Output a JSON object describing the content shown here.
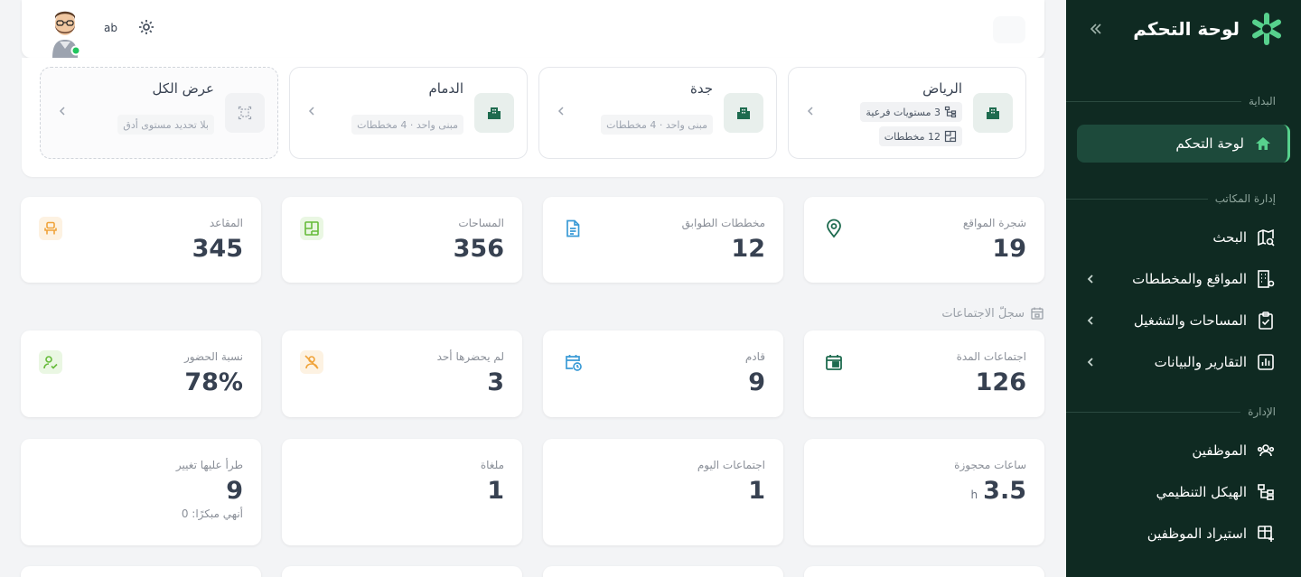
{
  "sidebar": {
    "title": "لوحة التحكم",
    "sections": {
      "start": "البداية",
      "offices": "إدارة المكاتب",
      "admin": "الإدارة"
    },
    "items": {
      "dashboard": "لوحة التحكم",
      "search": "البحث",
      "sites": "المواقع والمخططات",
      "spaces": "المساحات والتشغيل",
      "reports": "التقارير والبيانات",
      "employees": "الموظفين",
      "org": "الهيكل التنظيمي",
      "import": "استيراد الموظفين"
    }
  },
  "topbar": {
    "user_code": "ab"
  },
  "sites": [
    {
      "name": "الرياض",
      "chip1": "3 مستويات فرعية",
      "chip2": "12 مخططات"
    },
    {
      "name": "جدة",
      "chip1": "مبنى واحد · 4 مخططات"
    },
    {
      "name": "الدمام",
      "chip1": "مبنى واحد · 4 مخططات"
    },
    {
      "name": "عرض الكل",
      "chip1": "بلا تحديد مستوى أدق"
    }
  ],
  "stats_row1": [
    {
      "label": "شجرة المواقع",
      "value": "19"
    },
    {
      "label": "مخططات الطوابق",
      "value": "12"
    },
    {
      "label": "المساحات",
      "value": "356"
    },
    {
      "label": "المقاعد",
      "value": "345"
    }
  ],
  "meetings_section": "سجلّ الاجتماعات",
  "stats_row2": [
    {
      "label": "اجتماعات المدة",
      "value": "126"
    },
    {
      "label": "قادم",
      "value": "9"
    },
    {
      "label": "لم يحضرها أحد",
      "value": "3"
    },
    {
      "label": "نسبة الحضور",
      "value": "78%"
    }
  ],
  "stats_row3": [
    {
      "label": "ساعات محجوزة",
      "value": "3.5",
      "unit": "h"
    },
    {
      "label": "اجتماعات اليوم",
      "value": "1"
    },
    {
      "label": "ملغاة",
      "value": "1"
    },
    {
      "label": "طرأ عليها تغيير",
      "value": "9",
      "sub": "أنهي مبكرًا: 0"
    }
  ],
  "colors": {
    "sidebar_bg": "#0f2a22",
    "accent": "#57d18d",
    "green_icon": "#1e6b4f"
  }
}
